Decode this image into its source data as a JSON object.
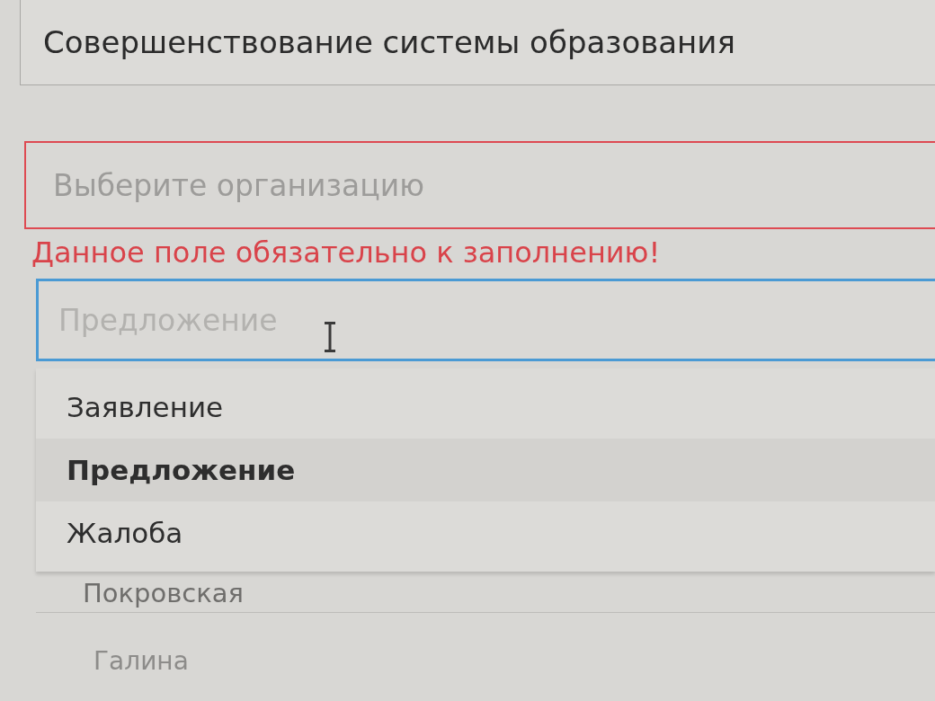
{
  "topic_field": {
    "value": "Совершенствование системы образования"
  },
  "organization_field": {
    "placeholder": "Выберите организацию",
    "invalid": true,
    "error_message": "Данное поле обязательно к заполнению!"
  },
  "type_field": {
    "placeholder": "Предложение",
    "focused": true,
    "expanded": true,
    "options": [
      {
        "label": "Заявление",
        "selected": false
      },
      {
        "label": "Предложение",
        "selected": true
      },
      {
        "label": "Жалоба",
        "selected": false
      }
    ]
  },
  "fields_below": [
    {
      "value": "Покровская"
    },
    {
      "value": "Галина"
    }
  ]
}
